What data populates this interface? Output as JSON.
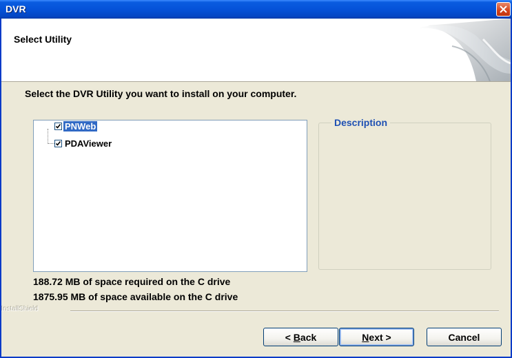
{
  "window": {
    "title": "DVR"
  },
  "header": {
    "title": "Select Utility"
  },
  "instruction": "Select the DVR Utility you want to install on your computer.",
  "components": [
    {
      "label": "PNWeb",
      "checked": true,
      "selected": true
    },
    {
      "label": "PDAViewer",
      "checked": true,
      "selected": false
    }
  ],
  "description": {
    "legend": "Description",
    "text": ""
  },
  "space": {
    "required": "188.72 MB of space required on the C drive",
    "available": "1875.95 MB of space available on the C drive"
  },
  "brand": "InstallShield",
  "buttons": {
    "back": {
      "prefix": "< ",
      "mnemonic": "B",
      "rest": "ack"
    },
    "next": {
      "mnemonic": "N",
      "rest": "ext >"
    },
    "cancel": "Cancel"
  },
  "colors": {
    "titlebar": "#0552d8",
    "selection": "#316ac5",
    "legend": "#1e50b3",
    "dialog_bg": "#ece9d8"
  }
}
